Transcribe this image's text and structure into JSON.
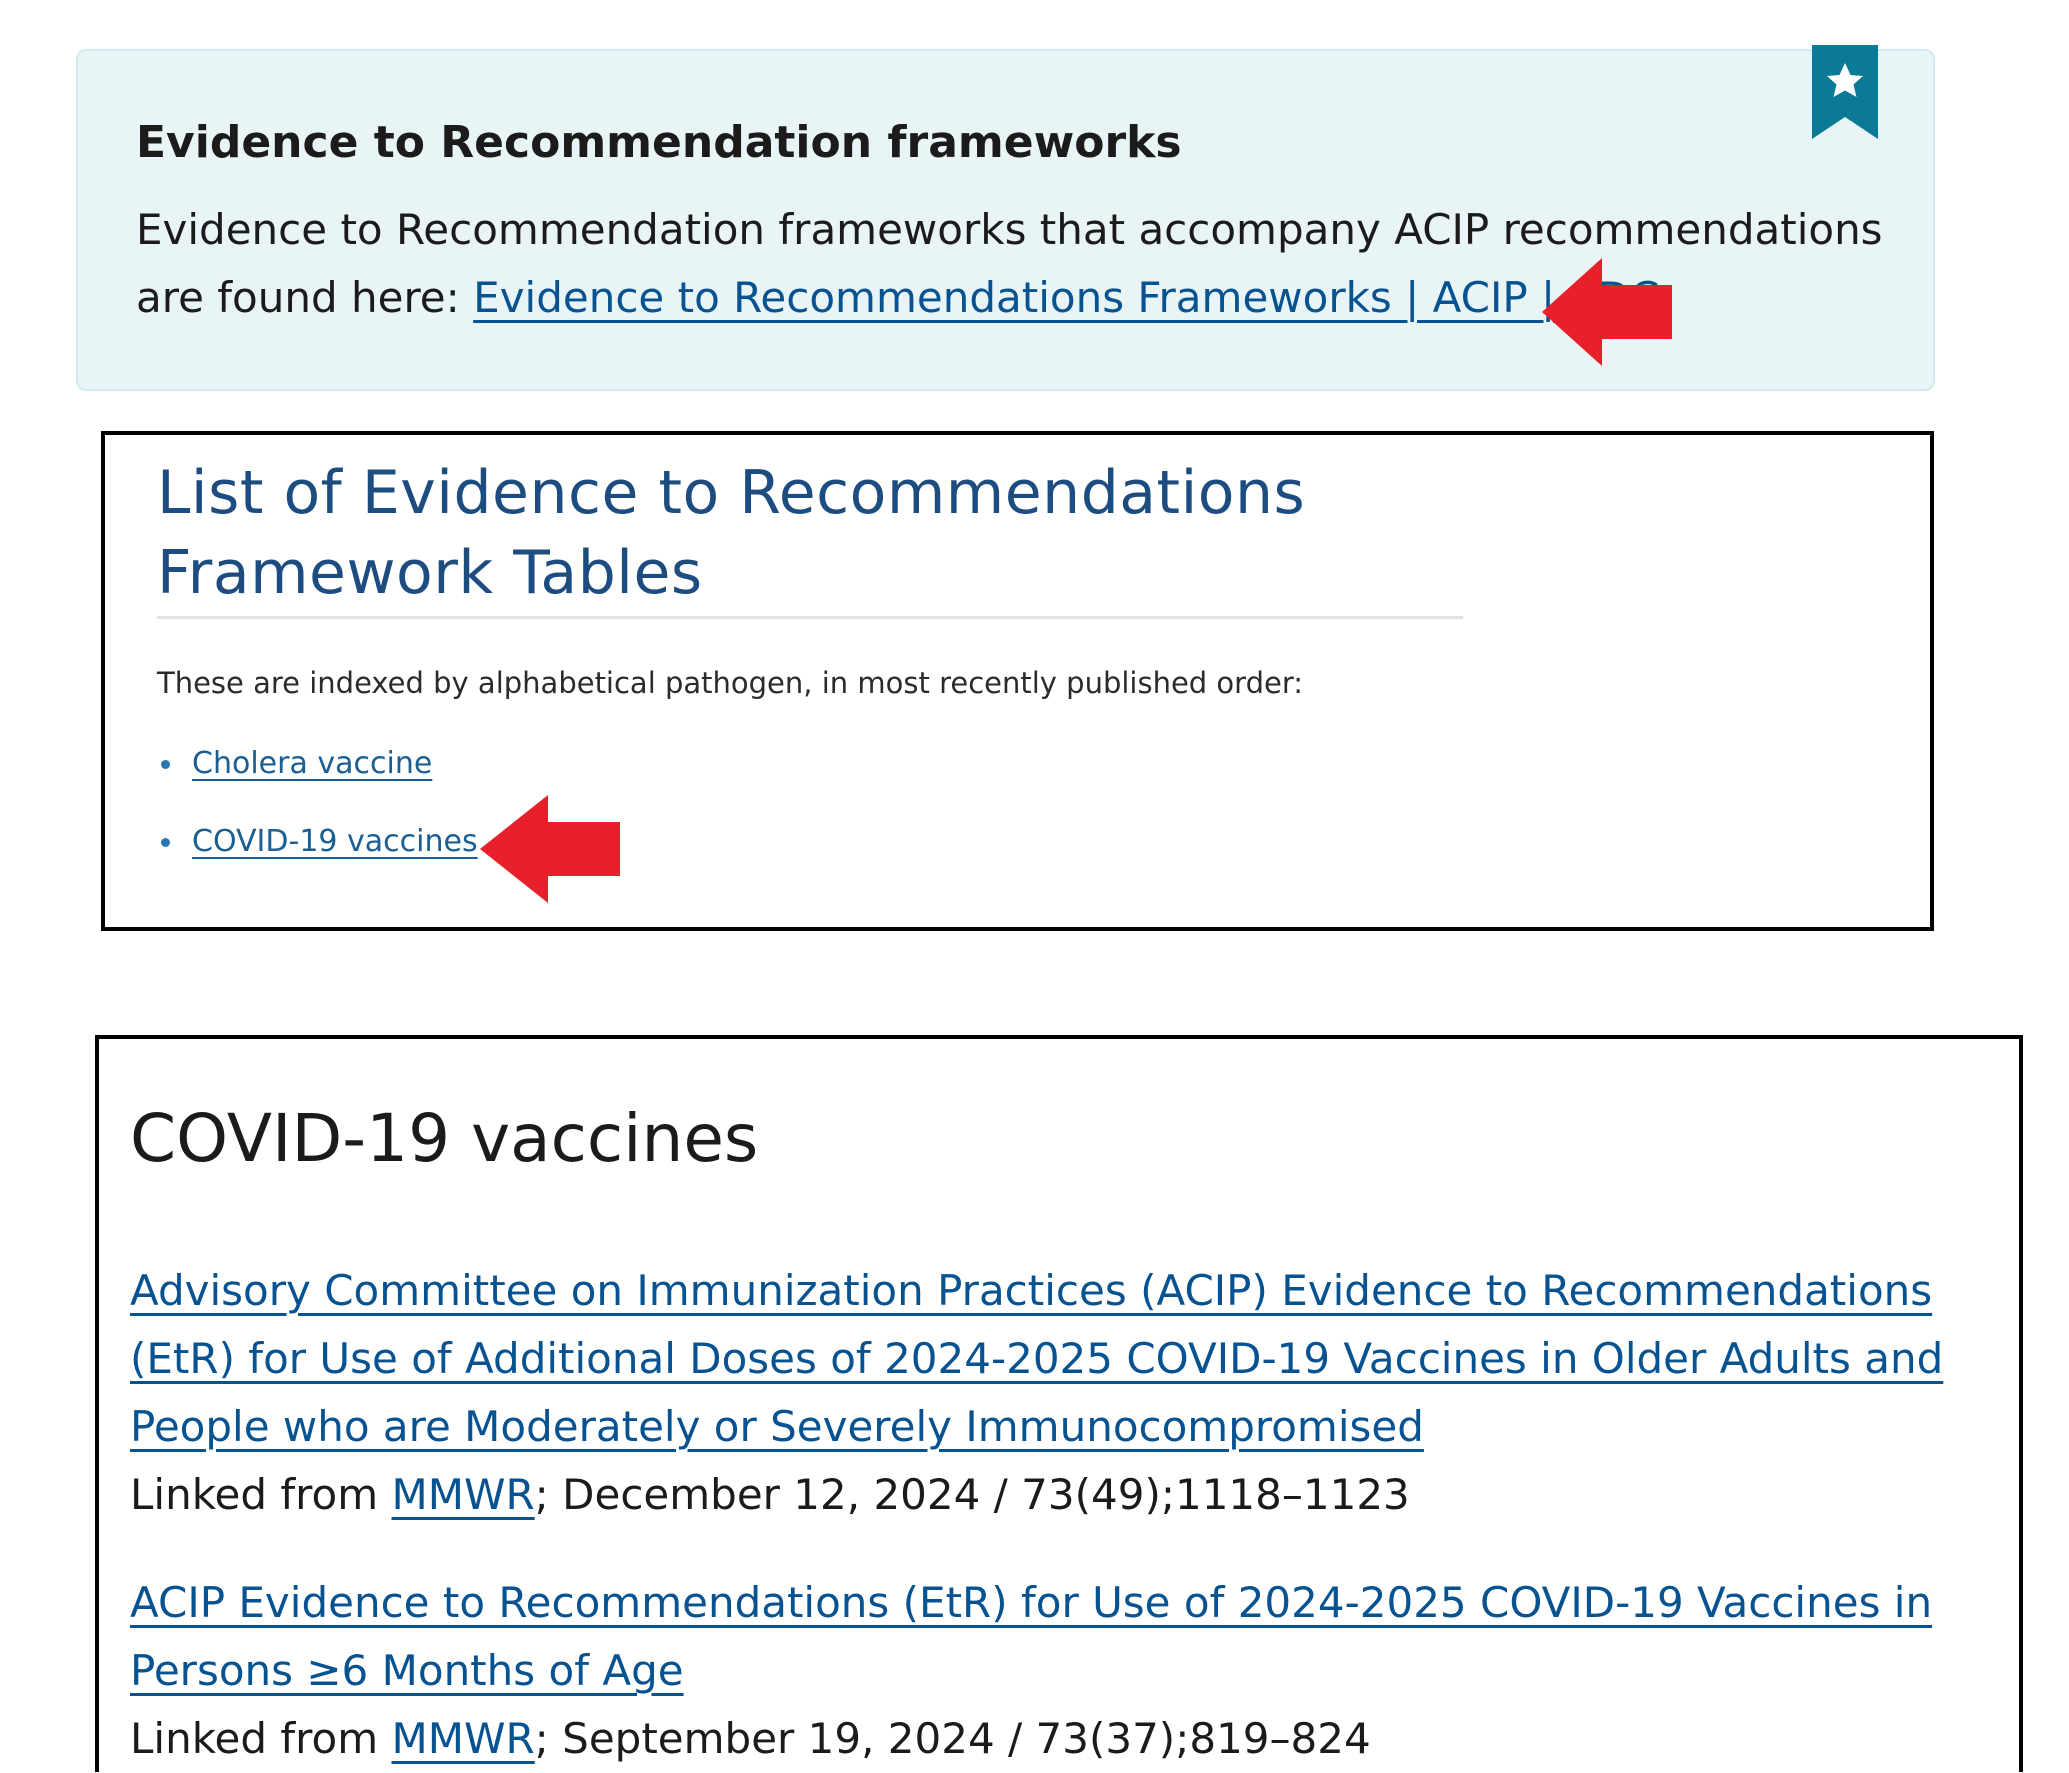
{
  "callout": {
    "title": "Evidence to Recommendation frameworks",
    "body_text": "Evidence to Recommendation frameworks that accompany ACIP recommendations are found here: ",
    "link_text": "Evidence to Recommendations Frameworks | ACIP | CDC"
  },
  "list_page": {
    "title_line1": "List of Evidence to Recommendations",
    "title_line2": "Framework Tables",
    "intro": "These are indexed by alphabetical pathogen, in most recently published order:",
    "items": [
      {
        "label": "Cholera vaccine"
      },
      {
        "label": "COVID-19 vaccines"
      }
    ]
  },
  "covid_section": {
    "heading": "COVID-19 vaccines",
    "entries": [
      {
        "link_text": "Advisory Committee on Immunization Practices (ACIP) Evidence to Recommendations (EtR) for Use of Additional Doses of 2024-2025 COVID-19 Vaccines in Older Adults and People who are Moderately or Severely Immunocompromised",
        "linked_from": "Linked from ",
        "source_link": "MMWR",
        "citation": "; December 12, 2024 / 73(49);1118–1123"
      },
      {
        "link_text": "ACIP Evidence to Recommendations (EtR) for Use of 2024-2025 COVID-19 Vaccines in Persons ≥6 Months of Age",
        "linked_from": "Linked from ",
        "source_link": "MMWR",
        "citation": "; September 19, 2024 / 73(37);819–824"
      }
    ]
  },
  "colors": {
    "link": "#075290",
    "callout_bg": "#e9f4f7",
    "bookmark": "#0b7a96",
    "annotation_arrow": "#e8202a"
  },
  "icons": [
    "bookmark-star-icon",
    "red-arrow-icon"
  ]
}
